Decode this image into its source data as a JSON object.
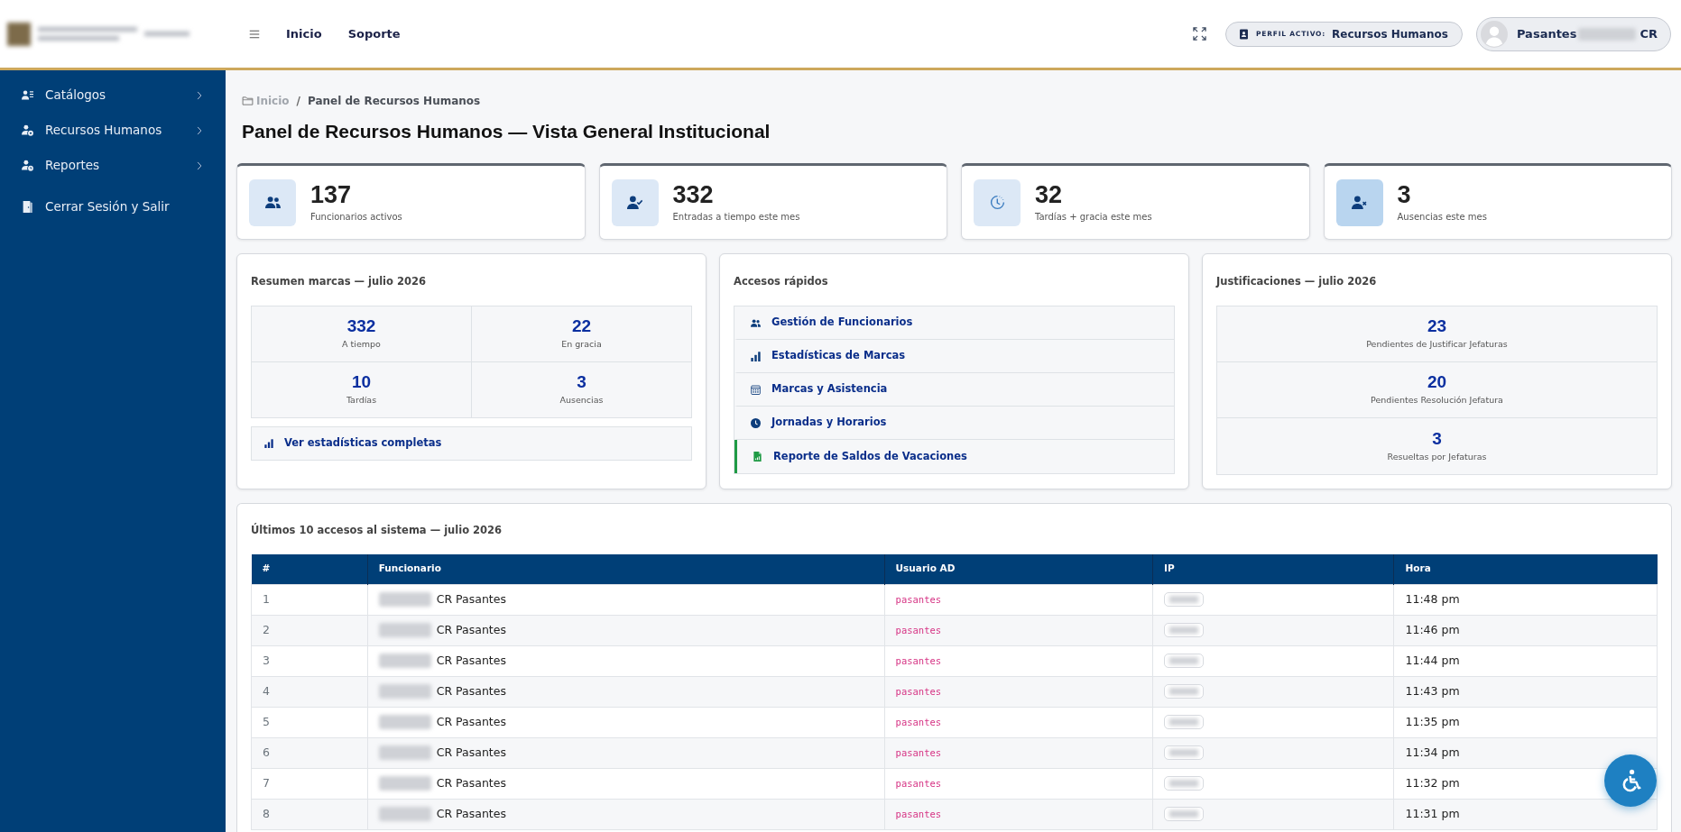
{
  "header": {
    "nav_links": [
      {
        "label": "Inicio"
      },
      {
        "label": "Soporte"
      }
    ],
    "profile": {
      "label": "PERFIL ACTIVO:",
      "value": "Recursos Humanos"
    },
    "user": {
      "first_name": "Pasantes",
      "last_name": "CR"
    }
  },
  "sidebar": {
    "items": [
      {
        "label": "Catálogos",
        "kind": "submenu"
      },
      {
        "label": "Recursos Humanos",
        "kind": "submenu"
      },
      {
        "label": "Reportes",
        "kind": "submenu"
      },
      {
        "label": "Cerrar Sesión y Salir",
        "kind": "action"
      }
    ]
  },
  "breadcrumb": {
    "separator": "/",
    "items": [
      {
        "label": "Inicio",
        "selected": false
      },
      {
        "label": "Panel de Recursos Humanos",
        "selected": true
      }
    ]
  },
  "page_title": "Panel de Recursos Humanos — Vista General Institucional",
  "stat_cards": [
    {
      "value": "137",
      "label": "Funcionarios activos",
      "color": "#dce8f6"
    },
    {
      "value": "332",
      "label": "Entradas a tiempo este mes",
      "color": "#dce8f6"
    },
    {
      "value": "32",
      "label": "Tardías + gracia este mes",
      "color": "#dce8f6"
    },
    {
      "value": "3",
      "label": "Ausencias este mes",
      "color": "#b9d5ef"
    }
  ],
  "summary_panel": {
    "title": "Resumen marcas — julio 2026",
    "cells": [
      {
        "value": "332",
        "label": "A tiempo"
      },
      {
        "value": "22",
        "label": "En gracia"
      },
      {
        "value": "10",
        "label": "Tardías"
      },
      {
        "value": "3",
        "label": "Ausencias"
      }
    ],
    "link": "Ver estadísticas completas"
  },
  "quick_access": {
    "title": "Accesos rápidos",
    "items": [
      {
        "label": "Gestión de Funcionarios",
        "highlighted": false
      },
      {
        "label": "Estadísticas de Marcas",
        "highlighted": false
      },
      {
        "label": "Marcas y Asistencia",
        "highlighted": false
      },
      {
        "label": "Jornadas y Horarios",
        "highlighted": false
      },
      {
        "label": "Reporte de Saldos de Vacaciones",
        "highlighted": true
      }
    ]
  },
  "justifications": {
    "title": "Justificaciones — julio 2026",
    "items": [
      {
        "value": "23",
        "label": "Pendientes de Justificar Jefaturas"
      },
      {
        "value": "20",
        "label": "Pendientes Resolución Jefatura"
      },
      {
        "value": "3",
        "label": "Resueltas por Jefaturas"
      }
    ]
  },
  "access_log": {
    "title": "Últimos 10 accesos al sistema — julio 2026",
    "columns": [
      "#",
      "Funcionario",
      "Usuario AD",
      "IP",
      "Hora"
    ],
    "rows": [
      {
        "number": "1",
        "funcionario": "CR Pasantes",
        "usuario_ad": "pasantes",
        "hora": "11:48 pm"
      },
      {
        "number": "2",
        "funcionario": "CR Pasantes",
        "usuario_ad": "pasantes",
        "hora": "11:46 pm"
      },
      {
        "number": "3",
        "funcionario": "CR Pasantes",
        "usuario_ad": "pasantes",
        "hora": "11:44 pm"
      },
      {
        "number": "4",
        "funcionario": "CR Pasantes",
        "usuario_ad": "pasantes",
        "hora": "11:43 pm"
      },
      {
        "number": "5",
        "funcionario": "CR Pasantes",
        "usuario_ad": "pasantes",
        "hora": "11:35 pm"
      },
      {
        "number": "6",
        "funcionario": "CR Pasantes",
        "usuario_ad": "pasantes",
        "hora": "11:34 pm"
      },
      {
        "number": "7",
        "funcionario": "CR Pasantes",
        "usuario_ad": "pasantes",
        "hora": "11:32 pm"
      },
      {
        "number": "8",
        "funcionario": "CR Pasantes",
        "usuario_ad": "pasantes",
        "hora": "11:31 pm"
      }
    ]
  }
}
